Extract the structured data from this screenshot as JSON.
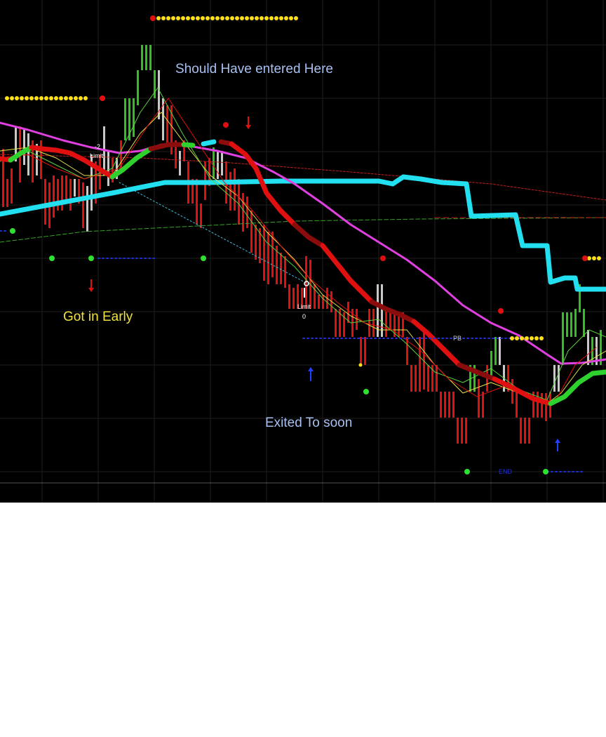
{
  "chart_data": {
    "type": "candlestick-overlay",
    "title": "",
    "xlabel": "",
    "ylabel": "",
    "grid": true,
    "colors": {
      "background": "#000000",
      "grid": "#1f1f1f",
      "bar_up": "#31c21f",
      "bar_down": "#e01010",
      "bar_neutral": "#c8c8c8",
      "cyan_band": "#22e0f0",
      "magenta_line": "#e040e0",
      "trend_red": "#e01010",
      "trend_darkred": "#8a0c0c",
      "trend_green": "#2ed12e",
      "thin_yellow": "#e6e24a",
      "thin_green": "#5bd13d",
      "dotted_red": "#c02020",
      "dashed_green": "#3aa02a",
      "dotted_blue": "#2030d0",
      "dotted_cyan": "#40c0e0",
      "dot_yellow": "#ffe01a",
      "dot_red": "#e01010",
      "dot_green": "#30e030",
      "arrow_red": "#e01010",
      "arrow_blue": "#2040ff",
      "text_blue": "#a8c0f0",
      "text_yellow": "#f0e040",
      "text_white": "#ffffff"
    },
    "annotations": {
      "should_have": "Should Have entered  Here",
      "got_in_early": "Got in Early",
      "exited": "Exited To soon",
      "limit_label_1": "Limit",
      "limit_label_2": "Limit",
      "limit_value_1": "-2",
      "limit_value_2": "0",
      "pb_label": "PB",
      "end_label": "END"
    }
  }
}
